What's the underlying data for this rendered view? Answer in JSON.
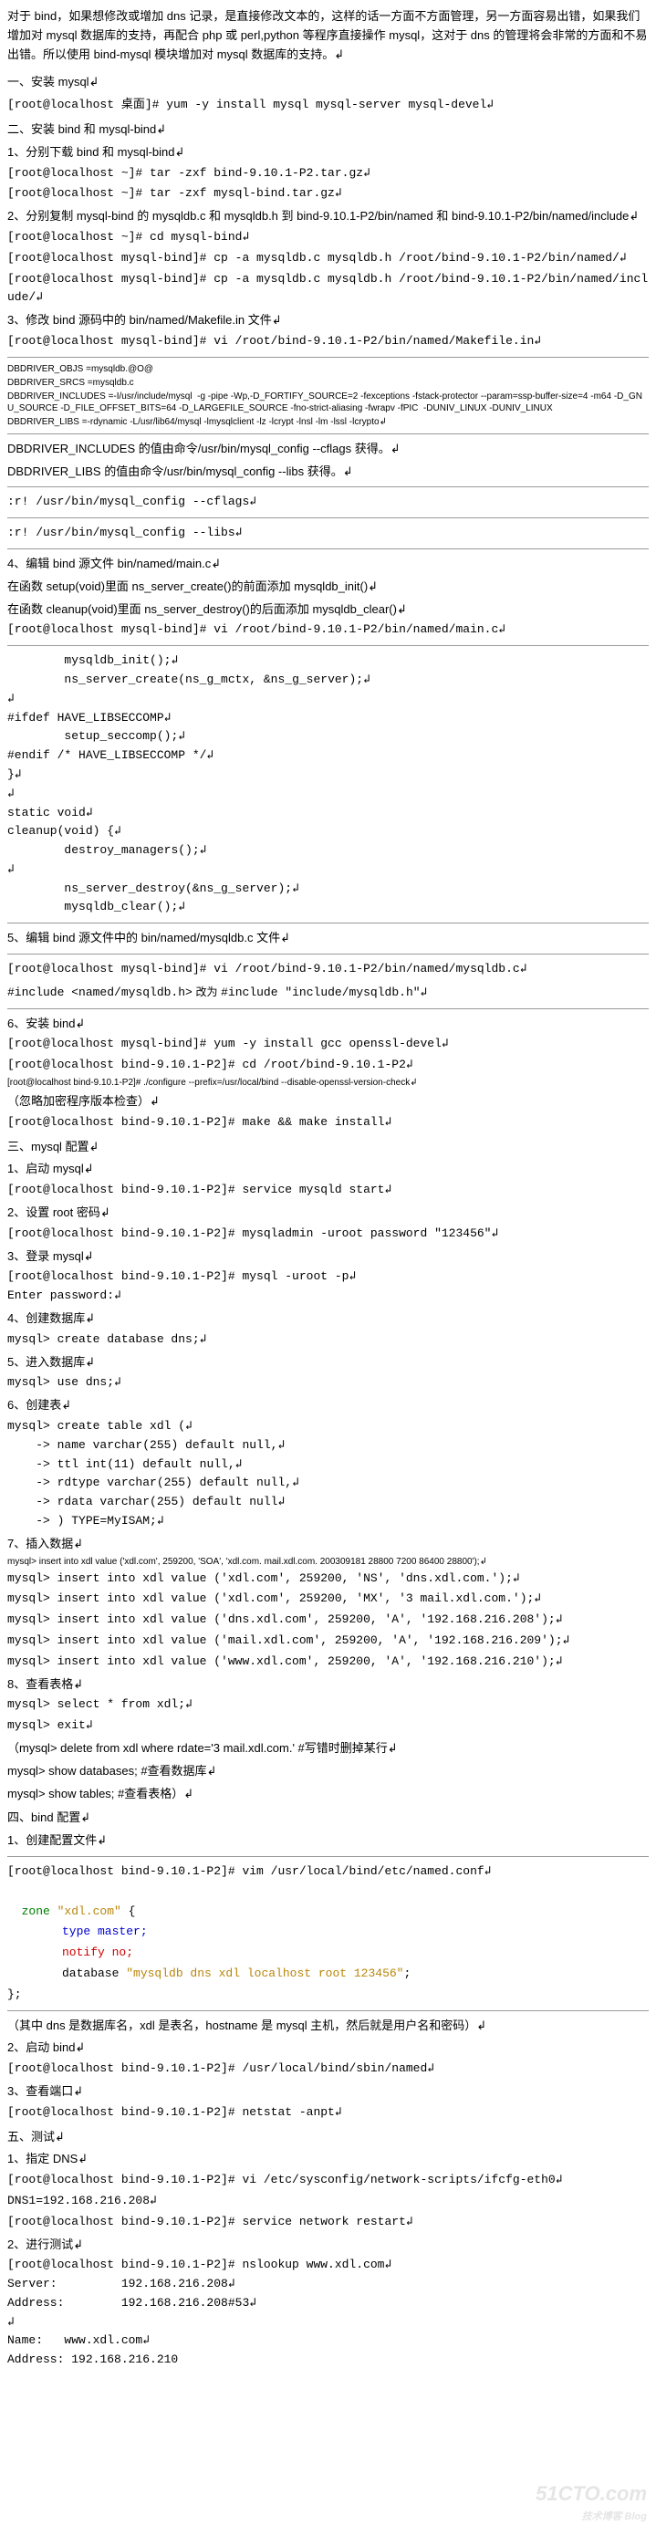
{
  "intro": "对于 bind，如果想修改或增加 dns 记录，是直接修改文本的，这样的话一方面不方面管理，另一方面容易出错，如果我们增加对 mysql 数据库的支持，再配合 php 或 perl,python 等程序直接操作 mysql，这对于 dns 的管理将会非常的方面和不易出错。所以使用 bind-mysql 模块增加对 mysql 数据库的支持。↲",
  "s1": "一、安装 mysql↲",
  "l1": "[root@localhost 桌面]# yum -y install mysql mysql-server mysql-devel↲",
  "s2": "二、安装 bind 和 mysql-bind↲",
  "sub2_1": "1、分别下载 bind 和 mysql-bind↲",
  "l2_1": "[root@localhost ~]# tar -zxf bind-9.10.1-P2.tar.gz↲",
  "l2_2": "[root@localhost ~]# tar -zxf mysql-bind.tar.gz↲",
  "sub2_2": "2、分别复制 mysql-bind 的 mysqldb.c 和 mysqldb.h 到 bind-9.10.1-P2/bin/named 和 bind-9.10.1-P2/bin/named/include↲",
  "l2_3": "[root@localhost ~]# cd mysql-bind↲",
  "l2_4": "[root@localhost mysql-bind]# cp -a mysqldb.c mysqldb.h /root/bind-9.10.1-P2/bin/named/↲",
  "l2_5": "[root@localhost mysql-bind]# cp -a mysqldb.c mysqldb.h /root/bind-9.10.1-P2/bin/named/include/↲",
  "sub2_3": "3、修改 bind 源码中的 bin/named/Makefile.in 文件↲",
  "l2_6": "[root@localhost mysql-bind]# vi /root/bind-9.10.1-P2/bin/named/Makefile.in↲",
  "mk1": "DBDRIVER_OBJS =mysqldb.@O@",
  "mk2": "DBDRIVER_SRCS =mysqldb.c",
  "mk3": "DBDRIVER_INCLUDES =-I/usr/include/mysql  -g -pipe -Wp,-D_FORTIFY_SOURCE=2 -fexceptions -fstack-protector --param=ssp-buffer-size=4 -m64 -D_GNU_SOURCE -D_FILE_OFFSET_BITS=64 -D_LARGEFILE_SOURCE -fno-strict-aliasing -fwrapv -fPIC  -DUNIV_LINUX -DUNIV_LINUX",
  "mk4": "DBDRIVER_LIBS =-rdynamic -L/usr/lib64/mysql -lmysqlclient -lz -lcrypt -lnsl -lm -lssl -lcrypto↲",
  "note1": "DBDRIVER_INCLUDES 的值由命令/usr/bin/mysql_config --cflags 获得。↲",
  "note2": "DBDRIVER_LIBS 的值由命令/usr/bin/mysql_config --libs 获得。↲",
  "cmd1": ":r! /usr/bin/mysql_config --cflags↲",
  "cmd2": ":r! /usr/bin/mysql_config --libs↲",
  "sub2_4": "4、编辑 bind 源文件 bin/named/main.c↲",
  "in1": "在函数 setup(void)里面 ns_server_create()的前面添加 mysqldb_init()↲",
  "in2": "在函数 cleanup(void)里面 ns_server_destroy()的后面添加 mysqldb_clear()↲",
  "l2_7": "[root@localhost mysql-bind]# vi /root/bind-9.10.1-P2/bin/named/main.c↲",
  "code1": "        mysqldb_init();↲\n        ns_server_create(ns_g_mctx, &ns_g_server);↲\n↲\n#ifdef HAVE_LIBSECCOMP↲\n        setup_seccomp();↲\n#endif /* HAVE_LIBSECCOMP */↲\n}↲\n↲\nstatic void↲\ncleanup(void) {↲\n        destroy_managers();↲\n↲\n        ns_server_destroy(&ns_g_server);↲\n        mysqldb_clear();↲",
  "sub2_5": "5、编辑 bind 源文件中的 bin/named/mysqldb.c 文件↲",
  "l2_8": "[root@localhost mysql-bind]# vi /root/bind-9.10.1-P2/bin/named/mysqldb.c↲",
  "inc_a": "#include <named/mysqldb.h>",
  "inc_mid": "改为",
  "inc_b": "#include \"include/mysqldb.h\"↲",
  "sub2_6": "6、安装 bind↲",
  "l2_9": "[root@localhost mysql-bind]# yum -y install gcc openssl-devel↲",
  "l2_10": "[root@localhost bind-9.10.1-P2]# cd /root/bind-9.10.1-P2↲",
  "l2_11": "[root@localhost bind-9.10.1-P2]# ./configure --prefix=/usr/local/bind --disable-openssl-version-check↲",
  "note3": "（忽略加密程序版本检查）↲",
  "l2_12": "[root@localhost bind-9.10.1-P2]# make && make install↲",
  "s3": "三、mysql 配置↲",
  "sub3_1": "1、启动 mysql↲",
  "l3_1": "[root@localhost bind-9.10.1-P2]# service mysqld start↲",
  "sub3_2": "2、设置 root 密码↲",
  "l3_2": "[root@localhost bind-9.10.1-P2]# mysqladmin -uroot password \"123456\"↲",
  "sub3_3": "3、登录 mysql↲",
  "l3_3": "[root@localhost bind-9.10.1-P2]# mysql -uroot -p↲\nEnter password:↲",
  "sub3_4": "4、创建数据库↲",
  "l3_4": "mysql> create database dns;↲",
  "sub3_5": "5、进入数据库↲",
  "l3_5": "mysql> use dns;↲",
  "sub3_6": "6、创建表↲",
  "l3_6": "mysql> create table xdl (↲\n    -> name varchar(255) default null,↲\n    -> ttl int(11) default null,↲\n    -> rdtype varchar(255) default null,↲\n    -> rdata varchar(255) default null↲\n    -> ) TYPE=MyISAM;↲",
  "sub3_7": "7、插入数据↲",
  "l3_7": "mysql> insert into xdl value ('xdl.com', 259200, 'SOA', 'xdl.com. mail.xdl.com. 200309181 28800 7200 86400 28800');↲",
  "l3_8": "mysql> insert into xdl value ('xdl.com', 259200, 'NS', 'dns.xdl.com.');↲",
  "l3_9": "mysql> insert into xdl value ('xdl.com', 259200, 'MX', '3 mail.xdl.com.');↲",
  "l3_10": "mysql> insert into xdl value ('dns.xdl.com', 259200, 'A', '192.168.216.208');↲",
  "l3_11": "mysql> insert into xdl value ('mail.xdl.com', 259200, 'A', '192.168.216.209');↲",
  "l3_12": "mysql> insert into xdl value ('www.xdl.com', 259200, 'A', '192.168.216.210');↲",
  "sub3_8": "8、查看表格↲",
  "l3_13": "mysql> select * from xdl;↲",
  "l3_14": "mysql> exit↲",
  "note4a": "（mysql> delete from xdl where rdate='3 mail.xdl.com.'     #写错时删掉某行↲",
  "note4b": "  mysql> show databases;       #查看数据库↲",
  "note4c": "  mysql> show tables;          #查看表格）↲",
  "s4": "四、bind 配置↲",
  "sub4_1": "1、创建配置文件↲",
  "l4_1": "[root@localhost bind-9.10.1-P2]# vim /usr/local/bind/etc/named.conf↲",
  "zone1": "zone",
  "zone2": " \"xdl.com\"",
  "zone3": " {",
  "zone4": "type master;",
  "zone5": "notify no;",
  "zone6": "database ",
  "zone7": "\"mysqldb dns xdl localhost root 123456\"",
  "zone8": ";",
  "zone9": "};",
  "note5": "（其中 dns 是数据库名，xdl 是表名，hostname 是 mysql 主机，然后就是用户名和密码）↲",
  "sub4_2": "2、启动 bind↲",
  "l4_2": "[root@localhost bind-9.10.1-P2]# /usr/local/bind/sbin/named↲",
  "sub4_3": "3、查看端口↲",
  "l4_3": "[root@localhost bind-9.10.1-P2]# netstat -anpt↲",
  "s5": "五、测试↲",
  "sub5_1": "1、指定 DNS↲",
  "l5_1": "[root@localhost bind-9.10.1-P2]# vi /etc/sysconfig/network-scripts/ifcfg-eth0↲",
  "l5_2": "DNS1=192.168.216.208↲",
  "l5_3": "[root@localhost bind-9.10.1-P2]# service network restart↲",
  "sub5_2": "2、进行测试↲",
  "l5_4": "[root@localhost bind-9.10.1-P2]# nslookup www.xdl.com↲\nServer:         192.168.216.208↲\nAddress:        192.168.216.208#53↲\n↲\nName:   www.xdl.com↲\nAddress: 192.168.216.210",
  "wm_big": "51CTO.com",
  "wm_sm": "技术博客  Blog"
}
